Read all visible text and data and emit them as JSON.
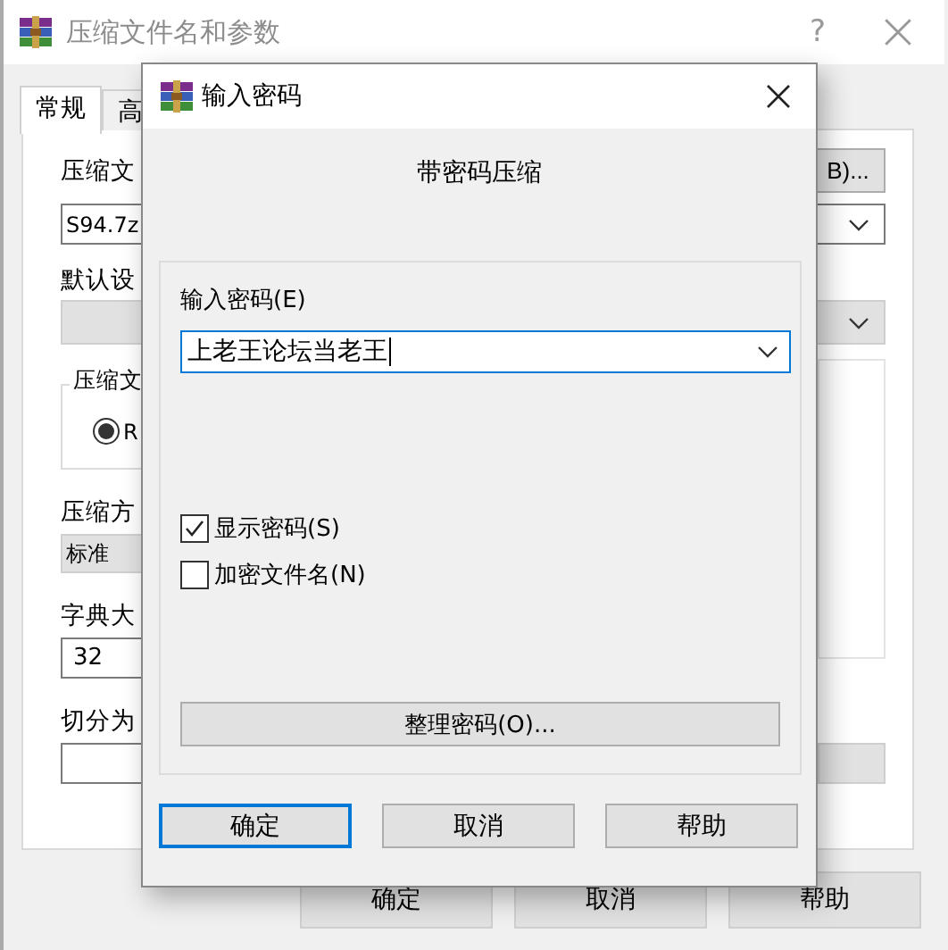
{
  "main_window": {
    "title": "压缩文件名和参数",
    "help_button": "?",
    "tabs": [
      {
        "label": "常规",
        "selected": true
      },
      {
        "label": "高",
        "selected": false
      }
    ],
    "archive_name": {
      "label": "压缩文",
      "browse_button": "B)...",
      "value": "S94.7z"
    },
    "profile": {
      "label": "默认设"
    },
    "format_group": {
      "label": "压缩文",
      "options": [
        {
          "label": "R",
          "selected": true
        }
      ]
    },
    "method": {
      "label": "压缩方",
      "value": "标准"
    },
    "dictionary": {
      "label": "字典大",
      "value": "32"
    },
    "split": {
      "label": "切分为"
    },
    "buttons": [
      "确定",
      "取消",
      "帮助"
    ]
  },
  "password_dialog": {
    "title": "输入密码",
    "heading": "带密码压缩",
    "password_label": "输入密码(E)",
    "password_value": "上老王论坛当老王",
    "options": [
      {
        "label": "显示密码(S)",
        "checked": true
      },
      {
        "label": "加密文件名(N)",
        "checked": false
      }
    ],
    "organize_button": "整理密码(O)...",
    "buttons": [
      {
        "label": "确定",
        "default": true
      },
      {
        "label": "取消",
        "default": false
      },
      {
        "label": "帮助",
        "default": false
      }
    ]
  }
}
